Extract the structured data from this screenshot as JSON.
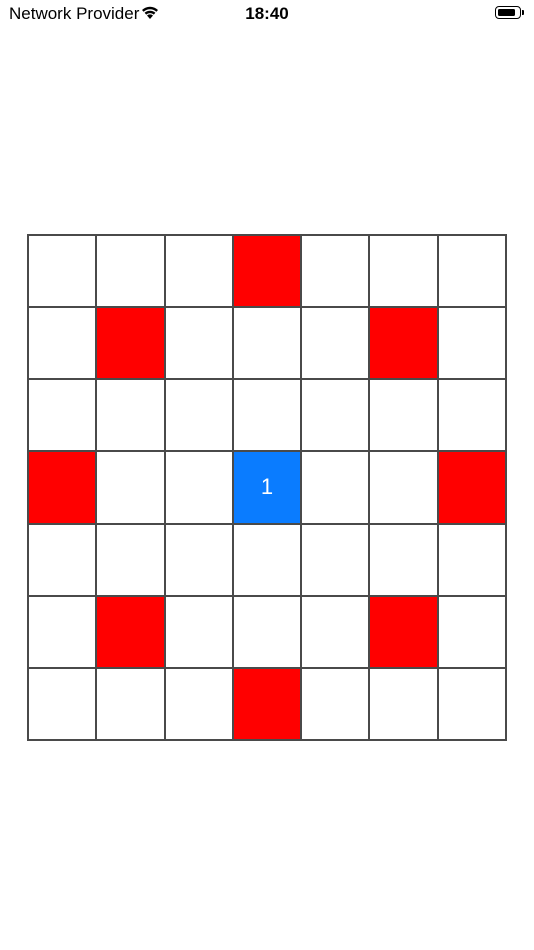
{
  "status_bar": {
    "carrier": "Network Provider",
    "time": "18:40",
    "wifi_icon": "wifi-icon",
    "battery_icon": "battery-icon",
    "battery_level": 0.9
  },
  "board": {
    "rows": 7,
    "cols": 7,
    "colors": {
      "empty": "#ffffff",
      "red": "#ff0000",
      "blue": "#0a7cff",
      "grid": "#4a4a4a"
    },
    "cells": [
      [
        {
          "state": "empty",
          "label": ""
        },
        {
          "state": "empty",
          "label": ""
        },
        {
          "state": "empty",
          "label": ""
        },
        {
          "state": "red",
          "label": ""
        },
        {
          "state": "empty",
          "label": ""
        },
        {
          "state": "empty",
          "label": ""
        },
        {
          "state": "empty",
          "label": ""
        }
      ],
      [
        {
          "state": "empty",
          "label": ""
        },
        {
          "state": "red",
          "label": ""
        },
        {
          "state": "empty",
          "label": ""
        },
        {
          "state": "empty",
          "label": ""
        },
        {
          "state": "empty",
          "label": ""
        },
        {
          "state": "red",
          "label": ""
        },
        {
          "state": "empty",
          "label": ""
        }
      ],
      [
        {
          "state": "empty",
          "label": ""
        },
        {
          "state": "empty",
          "label": ""
        },
        {
          "state": "empty",
          "label": ""
        },
        {
          "state": "empty",
          "label": ""
        },
        {
          "state": "empty",
          "label": ""
        },
        {
          "state": "empty",
          "label": ""
        },
        {
          "state": "empty",
          "label": ""
        }
      ],
      [
        {
          "state": "red",
          "label": ""
        },
        {
          "state": "empty",
          "label": ""
        },
        {
          "state": "empty",
          "label": ""
        },
        {
          "state": "blue",
          "label": "1"
        },
        {
          "state": "empty",
          "label": ""
        },
        {
          "state": "empty",
          "label": ""
        },
        {
          "state": "red",
          "label": ""
        }
      ],
      [
        {
          "state": "empty",
          "label": ""
        },
        {
          "state": "empty",
          "label": ""
        },
        {
          "state": "empty",
          "label": ""
        },
        {
          "state": "empty",
          "label": ""
        },
        {
          "state": "empty",
          "label": ""
        },
        {
          "state": "empty",
          "label": ""
        },
        {
          "state": "empty",
          "label": ""
        }
      ],
      [
        {
          "state": "empty",
          "label": ""
        },
        {
          "state": "red",
          "label": ""
        },
        {
          "state": "empty",
          "label": ""
        },
        {
          "state": "empty",
          "label": ""
        },
        {
          "state": "empty",
          "label": ""
        },
        {
          "state": "red",
          "label": ""
        },
        {
          "state": "empty",
          "label": ""
        }
      ],
      [
        {
          "state": "empty",
          "label": ""
        },
        {
          "state": "empty",
          "label": ""
        },
        {
          "state": "empty",
          "label": ""
        },
        {
          "state": "red",
          "label": ""
        },
        {
          "state": "empty",
          "label": ""
        },
        {
          "state": "empty",
          "label": ""
        },
        {
          "state": "empty",
          "label": ""
        }
      ]
    ]
  }
}
